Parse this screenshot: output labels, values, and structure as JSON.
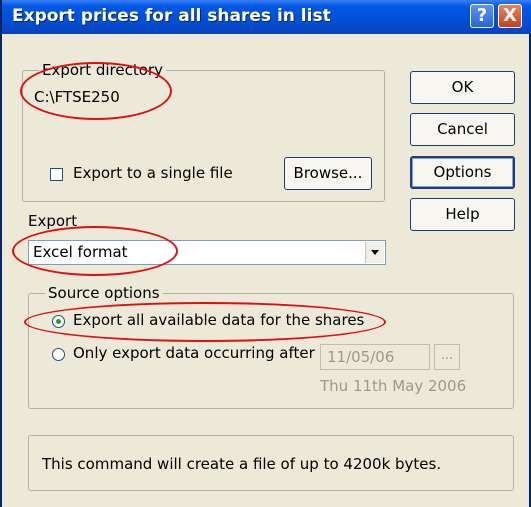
{
  "window": {
    "title": "Export prices for all shares in list",
    "help_glyph": "?",
    "close_glyph": "X"
  },
  "export_directory": {
    "legend": "Export directory",
    "path": "C:\\FTSE250",
    "single_file_label": "Export to a single file",
    "single_file_checked": false,
    "browse_label": "Browse..."
  },
  "buttons": {
    "ok": "OK",
    "cancel": "Cancel",
    "options": "Options",
    "help": "Help"
  },
  "export_format": {
    "label": "Export",
    "selected": "Excel format"
  },
  "source_options": {
    "legend": "Source options",
    "option_all": "Export all available data for the shares",
    "option_after": "Only export data occurring after",
    "selected": "option_all",
    "date_value": "11/05/06",
    "date_button": "...",
    "date_long": "Thu 11th May 2006"
  },
  "info": {
    "message": "This command will create a file of up to 4200k bytes."
  },
  "annotation_color": "#e01010"
}
